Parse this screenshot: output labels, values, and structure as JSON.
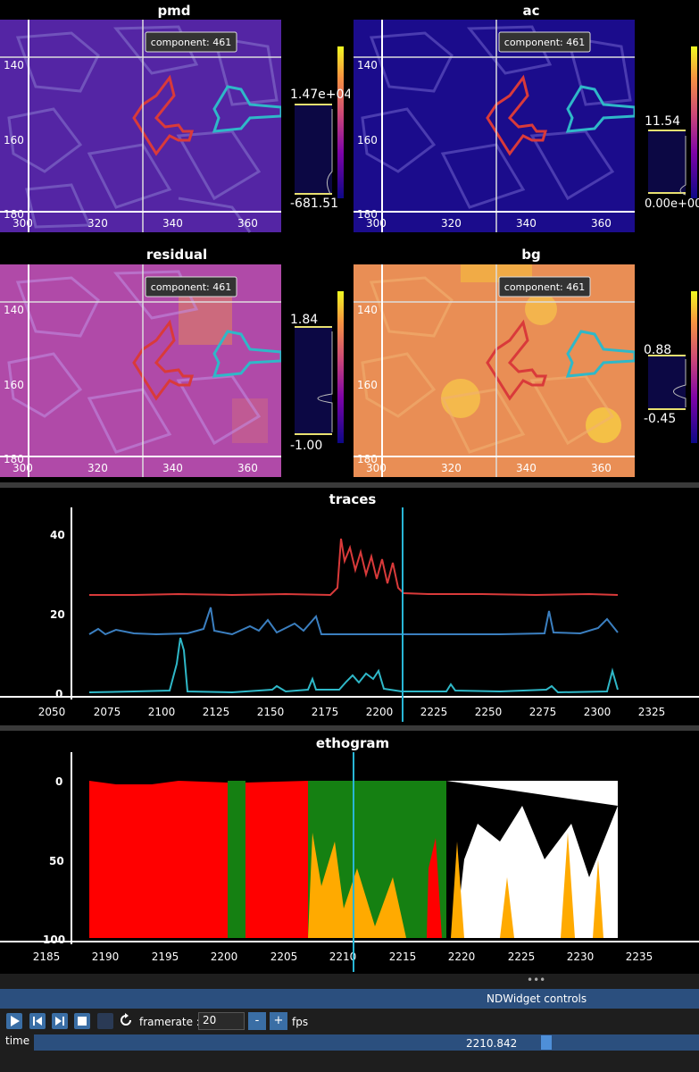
{
  "panels": {
    "pmd": {
      "title": "pmd",
      "component": "component: 461",
      "cb_top": "1.47e+04",
      "cb_bot": "-681.51"
    },
    "ac": {
      "title": "ac",
      "component": "component: 461",
      "cb_top": "11.54",
      "cb_bot": "0.00e+00"
    },
    "residual": {
      "title": "residual",
      "component": "component: 461",
      "cb_top": "1.84",
      "cb_bot": "-1.00"
    },
    "bg": {
      "title": "bg",
      "component": "component: 461",
      "cb_top": "0.88",
      "cb_bot": "-0.45"
    }
  },
  "image_axes": {
    "y_ticks": [
      "140",
      "160",
      "180"
    ],
    "x_ticks": [
      "300",
      "320",
      "340",
      "360"
    ]
  },
  "traces": {
    "title": "traces",
    "y_ticks": [
      "40",
      "20",
      "0"
    ],
    "x_ticks": [
      "2050",
      "2075",
      "2100",
      "2125",
      "2150",
      "2175",
      "2200",
      "2225",
      "2250",
      "2275",
      "2300",
      "2325"
    ],
    "cursor": 2210.842,
    "colors": {
      "red": "#d93a3a",
      "blue": "#3b7fc0",
      "cyan": "#2fb8c8",
      "cursor": "#29b6d6"
    }
  },
  "ethogram": {
    "title": "ethogram",
    "y_ticks": [
      "0",
      "50",
      "100"
    ],
    "x_ticks": [
      "2185",
      "2190",
      "2195",
      "2200",
      "2205",
      "2210",
      "2215",
      "2220",
      "2225",
      "2230",
      "2235"
    ],
    "colors": {
      "red": "#ff0000",
      "green": "#158012",
      "orange": "#ffaa00",
      "white": "#ffffff"
    }
  },
  "controls": {
    "header": "NDWidget controls",
    "framerate_label": "framerate :",
    "framerate_value": "20",
    "minus": "-",
    "plus": "+",
    "fps": "fps",
    "time_label": "time",
    "time_value": "2210.842",
    "time_fraction": 0.775
  }
}
